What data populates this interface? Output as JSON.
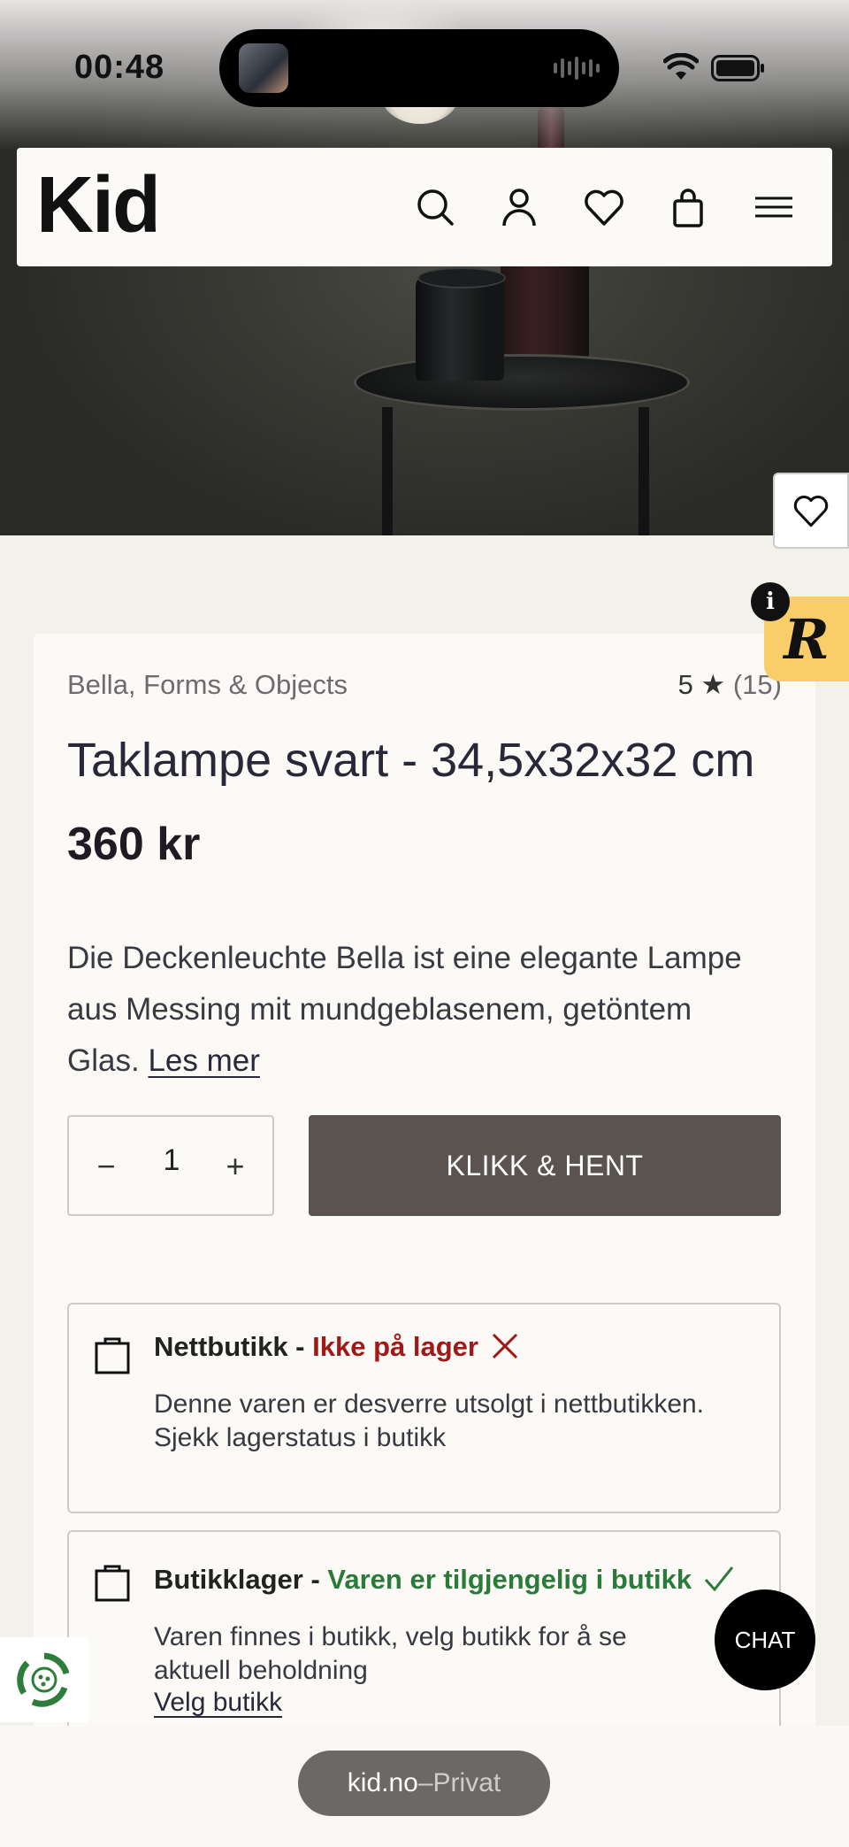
{
  "status_bar": {
    "time": "00:48"
  },
  "header": {
    "logo": "Kid"
  },
  "product": {
    "brand": "Bella, Forms & Objects",
    "rating": "5 ★",
    "rating_count": "(15)",
    "title": "Taklampe svart - 34,5x32x32 cm",
    "price": "360 kr",
    "description": "Die Deckenleuchte Bella ist eine elegante Lampe aus Messing mit mundgeblasenem, getöntem Glas.",
    "read_more": "Les mer"
  },
  "purchase": {
    "quantity": "1",
    "minus": "−",
    "plus": "+",
    "cta_label": "KLIKK & HENT"
  },
  "stock": {
    "online": {
      "label": "Nettbutikk - ",
      "status": "Ikke på lager",
      "status_color": "#a01818",
      "text": "Denne varen er desverre utsolgt i nettbutikken. Sjekk lagerstatus i butikk"
    },
    "store": {
      "label": "Butikklager - ",
      "status": "Varen er tilgjengelig i butikk",
      "status_color": "#2b7a3a",
      "text": "Varen finnes i butikk, velg butikk for å se aktuell beholdning",
      "link": "Velg butikk"
    }
  },
  "widgets": {
    "chat_label": "CHAT",
    "badge_letter": "R",
    "info_letter": "i"
  },
  "browser": {
    "domain": "kid.no",
    "separator": " – ",
    "mode": "Privat"
  },
  "icons": [
    "search-icon",
    "account-icon",
    "heart-icon",
    "bag-icon",
    "menu-icon",
    "wifi-icon",
    "battery-icon",
    "bag-outline-icon",
    "close-x-icon",
    "check-icon",
    "eco-recycle-icon"
  ]
}
